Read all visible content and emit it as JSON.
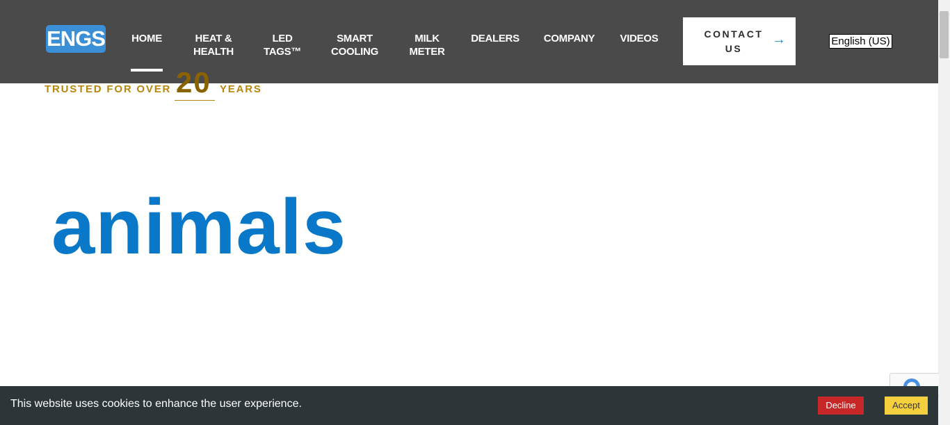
{
  "header": {
    "logo_text": "ENGS",
    "nav": [
      {
        "label": "HOME",
        "active": true
      },
      {
        "label": "HEAT &\nHEALTH"
      },
      {
        "label": "LED\nTAGS™"
      },
      {
        "label": "SMART\nCOOLING"
      },
      {
        "label": "MILK\nMETER"
      },
      {
        "label": "DEALERS"
      },
      {
        "label": "COMPANY"
      },
      {
        "label": "VIDEOS"
      }
    ],
    "contact_label": "CONTACT US",
    "contact_arrow": "→",
    "language": "English (US)"
  },
  "hero": {
    "trusted_prefix": "TRUSTED FOR OVER",
    "trusted_number": "20",
    "trusted_suffix": "YEARS",
    "rotating_word": "animals"
  },
  "cookie_bar": {
    "message": "This website uses cookies to enhance the user experience.",
    "decline_label": "Decline",
    "accept_label": "Accept"
  },
  "colors": {
    "header_bg": "#4a4a4a",
    "logo_bg": "#3b8fd6",
    "gold": "#b8860b",
    "hero_blue": "#0a78c8",
    "cookie_bg": "#2c3639",
    "decline_bg": "#c62828",
    "accept_bg": "#f4d03f"
  }
}
